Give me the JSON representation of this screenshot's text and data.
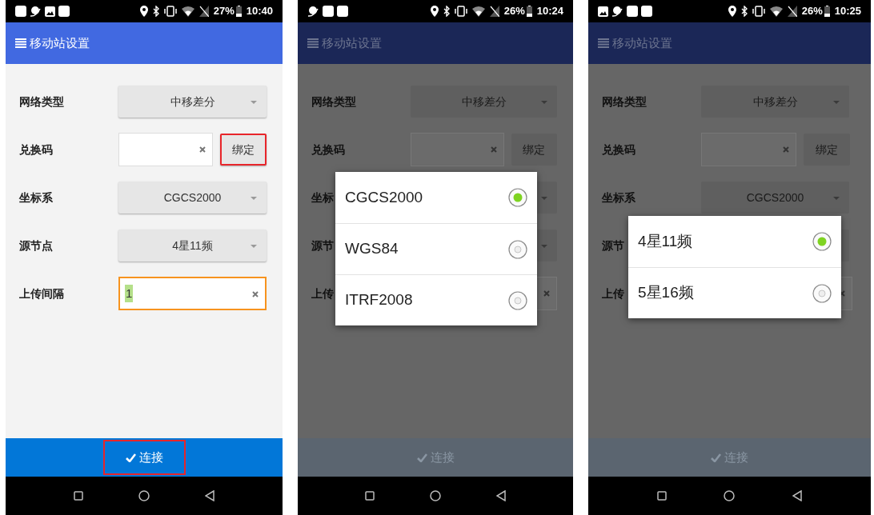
{
  "screens": [
    {
      "status_bar": {
        "notification_icons": [
          {
            "kind": "square"
          },
          {
            "kind": "swirl"
          },
          {
            "kind": "image"
          },
          {
            "kind": "square"
          }
        ],
        "battery": "27%",
        "time": "10:40"
      },
      "title": "移动站设置",
      "rows": [
        {
          "kind": "dropdown",
          "label": "网络类型",
          "value": "中移差分"
        },
        {
          "kind": "field_button",
          "label": "兑换码",
          "button": "绑定",
          "highlighted": true
        },
        {
          "kind": "dropdown",
          "label": "坐标系",
          "value": "CGCS2000"
        },
        {
          "kind": "dropdown",
          "label": "源节点",
          "value": "4星11频"
        },
        {
          "kind": "field",
          "label": "上传间隔",
          "value": "1",
          "focused": true
        }
      ],
      "connect_button": {
        "label": "连接",
        "highlighted": true
      }
    },
    {
      "status_bar": {
        "notification_icons": [
          {
            "kind": "swirl"
          },
          {
            "kind": "square"
          },
          {
            "kind": "square"
          }
        ],
        "battery": "26%",
        "time": "10:24"
      },
      "title": "移动站设置",
      "rows": [
        {
          "kind": "dropdown",
          "label": "网络类型",
          "value": "中移差分"
        },
        {
          "kind": "field_button",
          "label": "兑换码",
          "button": "绑定",
          "highlighted": false
        },
        {
          "kind": "dropdown",
          "label": "坐标"
        },
        {
          "kind": "dropdown",
          "label": "源节"
        },
        {
          "kind": "field",
          "label": "上传",
          "focused": false
        }
      ],
      "connect_button": {
        "label": "连接",
        "highlighted": false
      },
      "dialog": {
        "options": [
          {
            "label": "CGCS2000",
            "selected": true
          },
          {
            "label": "WGS84",
            "selected": false
          },
          {
            "label": "ITRF2008",
            "selected": false
          }
        ]
      }
    },
    {
      "status_bar": {
        "notification_icons": [
          {
            "kind": "image"
          },
          {
            "kind": "swirl"
          },
          {
            "kind": "square"
          },
          {
            "kind": "square"
          }
        ],
        "battery": "26%",
        "time": "10:25"
      },
      "title": "移动站设置",
      "rows": [
        {
          "kind": "dropdown",
          "label": "网络类型",
          "value": "中移差分"
        },
        {
          "kind": "field_button",
          "label": "兑换码",
          "button": "绑定",
          "highlighted": false
        },
        {
          "kind": "dropdown",
          "label": "坐标系",
          "value": "CGCS2000"
        },
        {
          "kind": "dropdown",
          "label": "源节"
        },
        {
          "kind": "field",
          "label": "上传",
          "focused": false
        }
      ],
      "connect_button": {
        "label": "连接",
        "highlighted": false
      },
      "dialog": {
        "options": [
          {
            "label": "4星11频",
            "selected": true
          },
          {
            "label": "5星16频",
            "selected": false
          }
        ]
      }
    }
  ]
}
